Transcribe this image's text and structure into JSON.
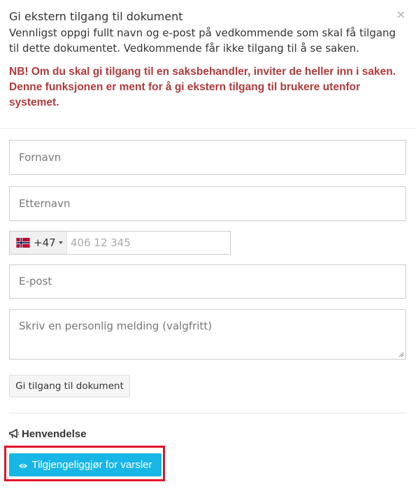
{
  "modal": {
    "title": "Gi ekstern tilgang til dokument",
    "description": "Vennligst oppgi fullt navn og e-post på vedkommende som skal få tilgang til dette dokumentet. Vedkommende får ikke tilgang til å se saken.",
    "warning": "NB! Om du skal gi tilgang til en saksbehandler, inviter de heller inn i saken. Denne funksjonen er ment for å gi ekstern tilgang til brukere utenfor systemet.",
    "close_icon": "×"
  },
  "form": {
    "first_name_placeholder": "Fornavn",
    "last_name_placeholder": "Etternavn",
    "phone": {
      "country_code": "+47",
      "flag": "norway-flag",
      "placeholder": "406 12 345"
    },
    "email_placeholder": "E-post",
    "message_placeholder": "Skriv en personlig melding (valgfritt)",
    "submit_label": "Gi tilgang til dokument"
  },
  "section": {
    "title": "Henvendelse",
    "icon": "megaphone-icon",
    "button_label": "Tilgjengeliggjør for varsler",
    "button_icon": "eye-icon"
  },
  "colors": {
    "warning": "#b03a3a",
    "accent_button": "#17b6e6",
    "highlight": "#e3132b"
  }
}
